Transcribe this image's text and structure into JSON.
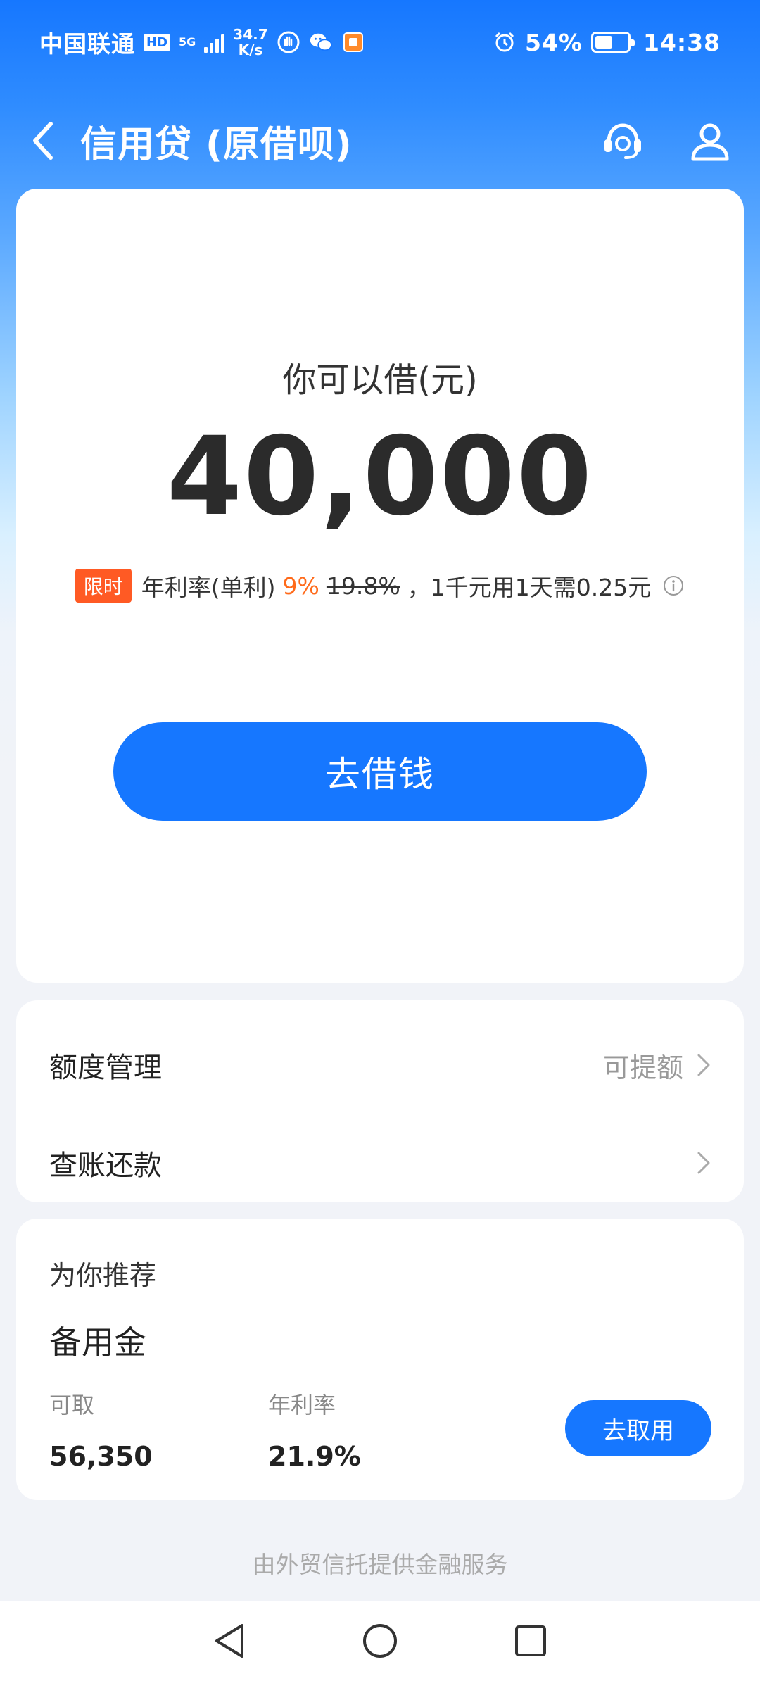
{
  "status_bar": {
    "carrier": "中国联通",
    "hd": "HD",
    "network": "5G",
    "speed_value": "34.7",
    "speed_unit": "K/s",
    "battery": "54%",
    "battery_level": 0.54,
    "time": "14:38"
  },
  "header": {
    "title": "信用贷 (原借呗)",
    "back_icon": "chevron-left-icon",
    "service_icon": "headset-icon",
    "profile_icon": "user-icon"
  },
  "loan": {
    "label": "你可以借(元)",
    "amount": "40,000",
    "limited_tag": "限时",
    "rate_label": "年利率(单利)",
    "rate_now": "9%",
    "rate_old": "19.8%",
    "rate_note": "，1千元用1天需0.25元",
    "button": "去借钱"
  },
  "menu": {
    "quota_label": "额度管理",
    "quota_hint": "可提额",
    "bill_label": "查账还款"
  },
  "recommend": {
    "title": "为你推荐",
    "product": "备用金",
    "available_label": "可取",
    "available_value": "56,350",
    "rate_label": "年利率",
    "rate_value": "21.9%",
    "button": "去取用"
  },
  "footer": {
    "note": "由外贸信托提供金融服务"
  },
  "colors": {
    "primary": "#1677ff",
    "accent_orange": "#ff6a1a",
    "tag_bg": "#ff5a24"
  }
}
